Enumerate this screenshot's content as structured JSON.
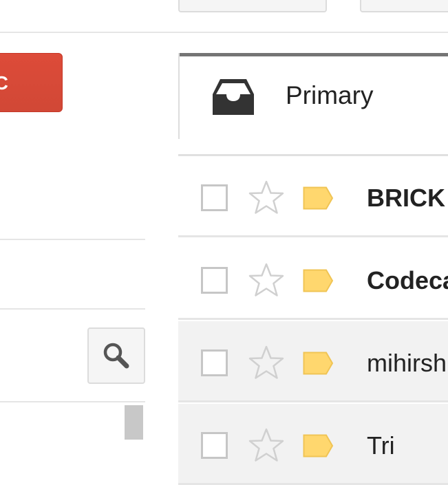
{
  "toolbar": {
    "buttons": [
      "",
      ""
    ]
  },
  "sidebar": {
    "compose_label": "C"
  },
  "tabs": [
    {
      "label": "Primary",
      "icon": "inbox-icon",
      "selected": true
    }
  ],
  "emails": [
    {
      "sender": "BRICK",
      "read": false,
      "starred": false,
      "label_color": "#ffd76e"
    },
    {
      "sender": "Codeca",
      "read": false,
      "starred": false,
      "label_color": "#ffd76e"
    },
    {
      "sender": "mihirsh",
      "read": true,
      "starred": false,
      "label_color": "#ffd76e"
    },
    {
      "sender": "Tri",
      "read": true,
      "starred": false,
      "label_color": "#ffd76e"
    }
  ],
  "colors": {
    "compose": "#dd4b39",
    "label": "#ffd76e",
    "tab_indicator": "#757575"
  }
}
